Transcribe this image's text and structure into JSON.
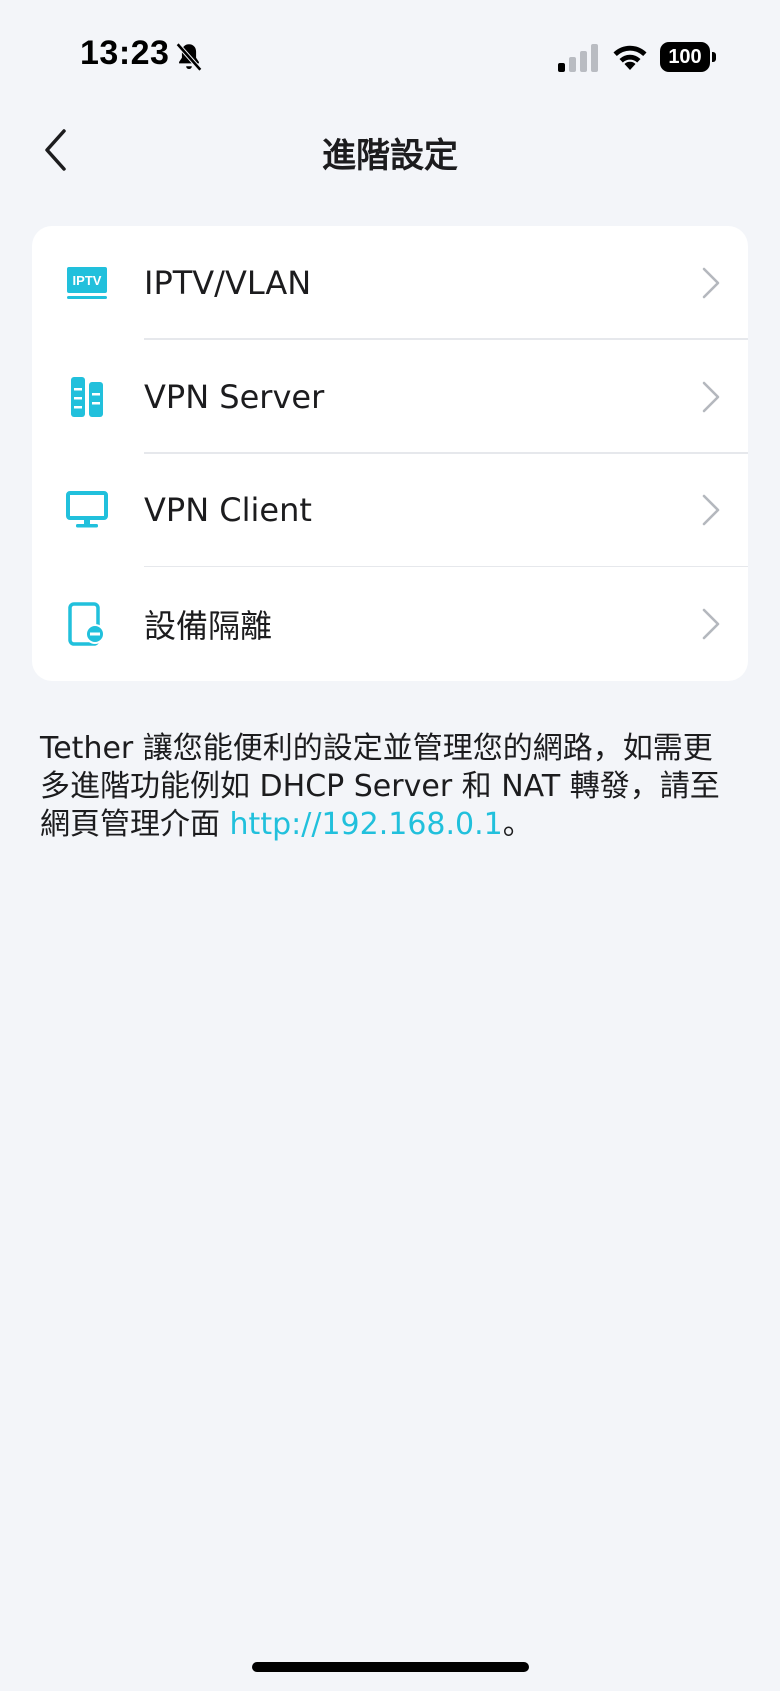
{
  "status_bar": {
    "time": "13:23",
    "battery": "100",
    "icons": [
      "bell-slash-icon",
      "cellular-signal-icon",
      "wifi-icon",
      "battery-icon"
    ]
  },
  "nav": {
    "title": "進階設定",
    "back_icon": "chevron-left-icon"
  },
  "menu": {
    "items": [
      {
        "label": "IPTV/VLAN",
        "icon": "iptv-icon",
        "icon_text": "IPTV"
      },
      {
        "label": "VPN Server",
        "icon": "vpn-server-icon"
      },
      {
        "label": "VPN Client",
        "icon": "monitor-icon"
      },
      {
        "label": "設備隔離",
        "icon": "device-isolation-icon"
      }
    ]
  },
  "description": {
    "text": "Tether 讓您能便利的設定並管理您的網路，如需更多進階功能例如 DHCP Server 和 NAT 轉發，請至網頁管理介面 ",
    "link": "http://192.168.0.1",
    "suffix": "。"
  },
  "colors": {
    "accent": "#21c0dc",
    "background": "#f3f5f9",
    "card": "#ffffff"
  }
}
